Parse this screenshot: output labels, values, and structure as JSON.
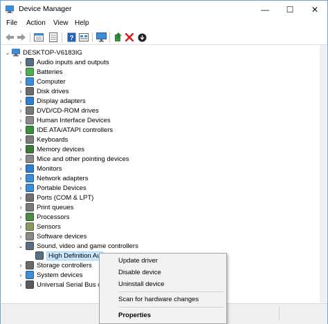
{
  "window": {
    "title": "Device Manager"
  },
  "window_controls": {
    "minimize": "—",
    "maximize": "☐",
    "close": "✕"
  },
  "menu": [
    "File",
    "Action",
    "View",
    "Help"
  ],
  "toolbar_icons": [
    "back-icon",
    "forward-icon",
    "properties-icon",
    "show-hide-icon",
    "help-icon",
    "view-icon",
    "monitor-icon",
    "update-driver-icon",
    "uninstall-icon",
    "scan-icon"
  ],
  "tree": {
    "root": "DESKTOP-V6183IG",
    "categories": [
      {
        "label": "Audio inputs and outputs",
        "icon": "speaker-icon",
        "color": "#5a6e84"
      },
      {
        "label": "Batteries",
        "icon": "battery-icon",
        "color": "#4caf50"
      },
      {
        "label": "Computer",
        "icon": "computer-icon",
        "color": "#3d8ed8"
      },
      {
        "label": "Disk drives",
        "icon": "disk-icon",
        "color": "#6c6c6c"
      },
      {
        "label": "Display adapters",
        "icon": "display-icon",
        "color": "#2f7fd1"
      },
      {
        "label": "DVD/CD-ROM drives",
        "icon": "dvd-icon",
        "color": "#777777"
      },
      {
        "label": "Human Interface Devices",
        "icon": "hid-icon",
        "color": "#8a8a8a"
      },
      {
        "label": "IDE ATA/ATAPI controllers",
        "icon": "ide-icon",
        "color": "#3a8f3a"
      },
      {
        "label": "Keyboards",
        "icon": "keyboard-icon",
        "color": "#7b7b7b"
      },
      {
        "label": "Memory devices",
        "icon": "memory-icon",
        "color": "#3c7a3c"
      },
      {
        "label": "Mice and other pointing devices",
        "icon": "mouse-icon",
        "color": "#8a8a8a"
      },
      {
        "label": "Monitors",
        "icon": "monitor-icon",
        "color": "#2f7fd1"
      },
      {
        "label": "Network adapters",
        "icon": "network-icon",
        "color": "#3d8ed8"
      },
      {
        "label": "Portable Devices",
        "icon": "portable-icon",
        "color": "#3d8ed8"
      },
      {
        "label": "Ports (COM & LPT)",
        "icon": "port-icon",
        "color": "#707070"
      },
      {
        "label": "Print queues",
        "icon": "printer-icon",
        "color": "#7b7b7b"
      },
      {
        "label": "Processors",
        "icon": "processor-icon",
        "color": "#4b8b4b"
      },
      {
        "label": "Sensors",
        "icon": "sensor-icon",
        "color": "#8a9a5a"
      },
      {
        "label": "Software devices",
        "icon": "software-icon",
        "color": "#8a8a8a"
      },
      {
        "label": "Sound, video and game controllers",
        "icon": "sound-icon",
        "color": "#5a6e84",
        "expanded": true
      },
      {
        "label": "Storage controllers",
        "icon": "storage-icon",
        "color": "#6a6a6a"
      },
      {
        "label": "System devices",
        "icon": "system-icon",
        "color": "#3d8ed8"
      },
      {
        "label": "Universal Serial Bus co",
        "icon": "usb-icon",
        "color": "#5a5a5a"
      }
    ],
    "selected_child": "High Definition Au"
  },
  "context_menu": {
    "items": [
      "Update driver",
      "Disable device",
      "Uninstall device",
      "Scan for hardware changes",
      "Properties"
    ]
  }
}
